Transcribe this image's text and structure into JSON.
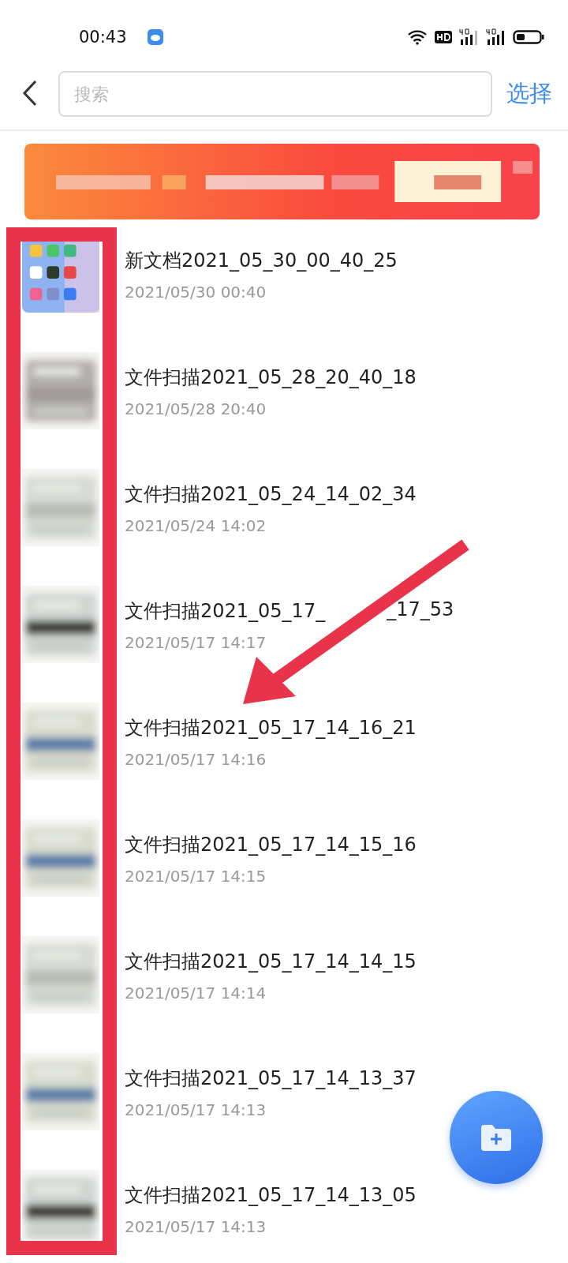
{
  "status_bar": {
    "time": "00:43"
  },
  "header": {
    "search": {
      "placeholder": "搜索"
    },
    "select_label": "选择"
  },
  "files": [
    {
      "title": "新文档2021_05_30_00_40_25",
      "date": "2021/05/30 00:40"
    },
    {
      "title": "文件扫描2021_05_28_20_40_18",
      "date": "2021/05/28 20:40"
    },
    {
      "title": "文件扫描2021_05_24_14_02_34",
      "date": "2021/05/24 14:02"
    },
    {
      "title": "文件扫描2021_05_17_",
      "title_after_arrow": "_17_53",
      "date": "2021/05/17 14:17"
    },
    {
      "title": "文件扫描2021_05_17_14_16_21",
      "date": "2021/05/17 14:16"
    },
    {
      "title": "文件扫描2021_05_17_14_15_16",
      "date": "2021/05/17 14:15"
    },
    {
      "title": "文件扫描2021_05_17_14_14_15",
      "date": "2021/05/17 14:14"
    },
    {
      "title": "文件扫描2021_05_17_14_13_37",
      "date": "2021/05/17 14:13"
    },
    {
      "title": "文件扫描2021_05_17_14_13_05",
      "date": "2021/05/17 14:13"
    }
  ]
}
